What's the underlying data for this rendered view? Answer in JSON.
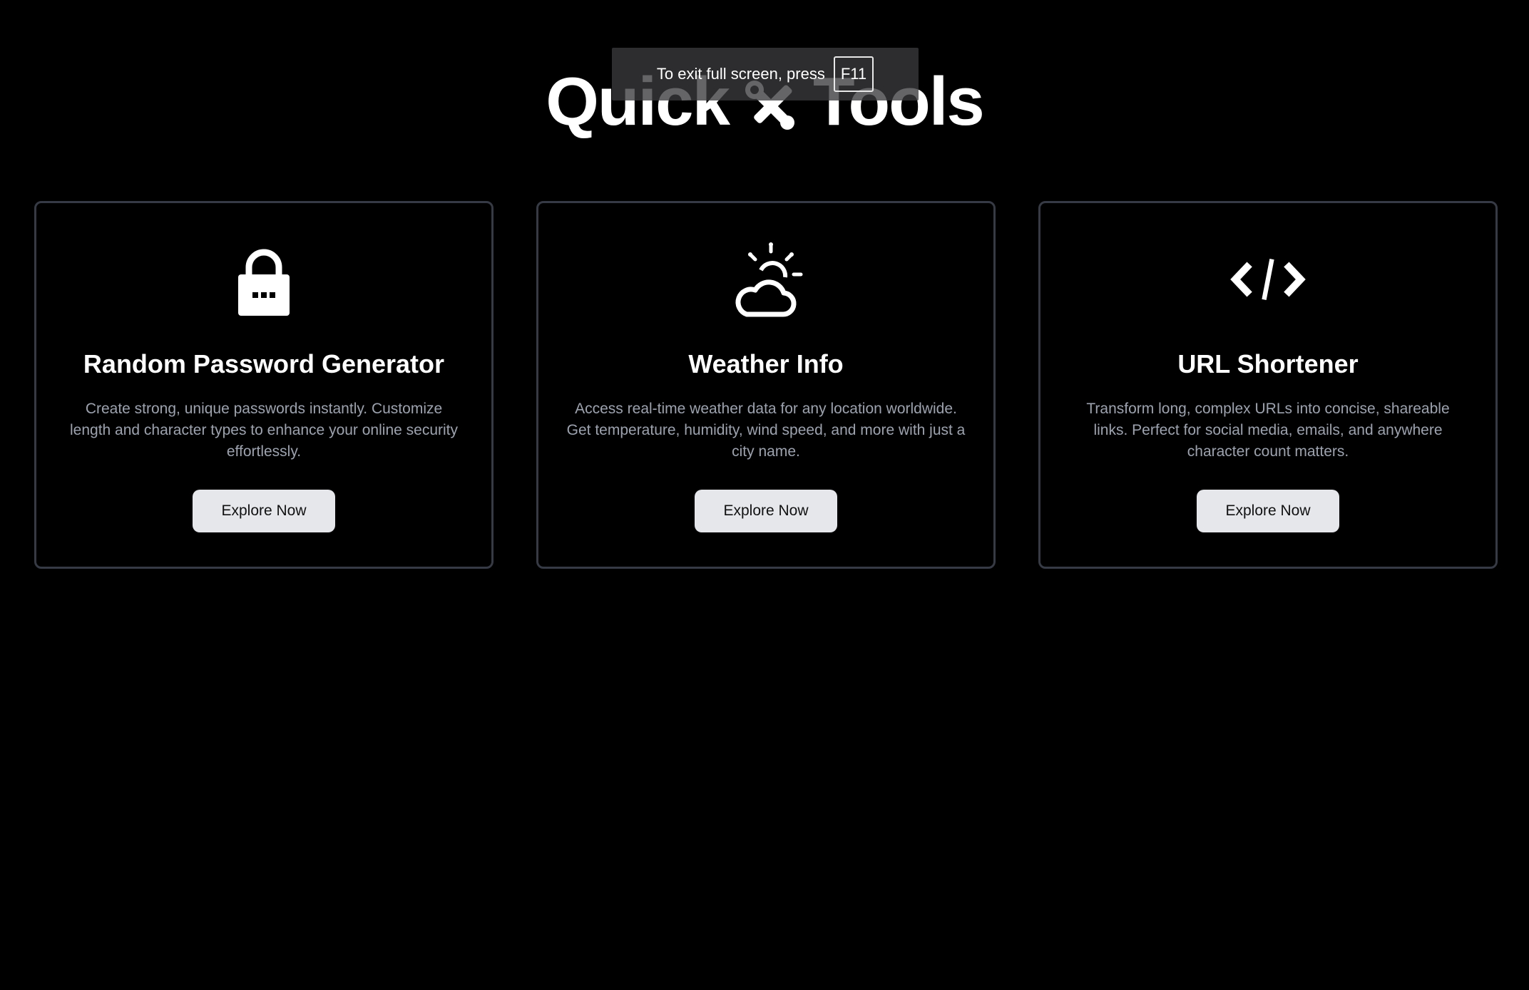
{
  "header": {
    "title_before": "Quick",
    "title_icon": "tools-icon",
    "title_after": "Tools"
  },
  "fullscreen_notice": {
    "text": "To exit full screen, press",
    "key": "F11"
  },
  "cards": [
    {
      "icon": "lock-icon",
      "title": "Random Password Generator",
      "description": "Create strong, unique passwords instantly. Customize length and character types to enhance your online security effortlessly.",
      "button_label": "Explore Now"
    },
    {
      "icon": "weather-icon",
      "title": "Weather Info",
      "description": "Access real-time weather data for any location worldwide. Get temperature, humidity, wind speed, and more with just a city name.",
      "button_label": "Explore Now"
    },
    {
      "icon": "code-icon",
      "title": "URL Shortener",
      "description": "Transform long, complex URLs into concise, shareable links. Perfect for social media, emails, and anywhere character count matters.",
      "button_label": "Explore Now"
    }
  ],
  "colors": {
    "background": "#000000",
    "card_border": "#353a44",
    "description_text": "#9ca3af",
    "button_background": "#e5e7eb"
  }
}
